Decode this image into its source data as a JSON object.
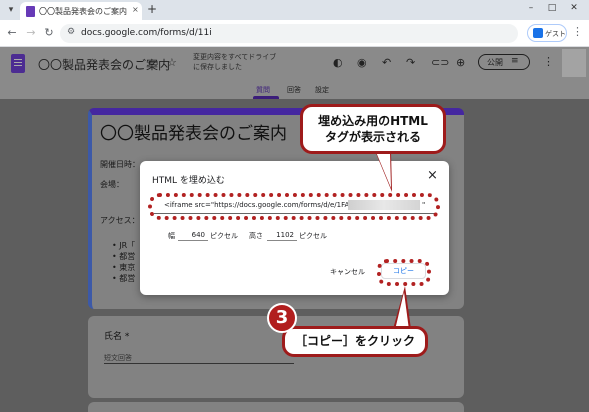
{
  "browser": {
    "tab_title": "〇〇製品発表会のご案内 - Google",
    "tab_close": "×",
    "new_tab": "+",
    "url": "docs.google.com/forms/d/11i",
    "profile_label": "ゲスト"
  },
  "form_header": {
    "title": "〇〇製品発表会のご案内",
    "save_note": "変更内容をすべてドライブに保存しました",
    "publish_label": "公開",
    "tabs": [
      {
        "label": "質問"
      },
      {
        "label": "回答"
      },
      {
        "label": "設定"
      }
    ]
  },
  "form_body": {
    "title": "〇〇製品発表会のご案内",
    "datetime_label": "開催日時：",
    "venue_label": "会場：",
    "access_label": "アクセス：",
    "bullets": [
      "JR「",
      "都営",
      "東京",
      "都営"
    ],
    "question_label": "氏名 *",
    "answer_placeholder": "短文回答"
  },
  "dialog": {
    "title": "HTML を埋め込む",
    "close": "×",
    "code": "<iframe src=\"https://docs.google.com/forms/d/e/1FAIp",
    "code_tail": "\"",
    "width_label": "幅",
    "width_value": "640",
    "width_unit": "ピクセル",
    "height_label": "高さ",
    "height_value": "1102",
    "height_unit": "ピクセル",
    "cancel_label": "キャンセル",
    "copy_label": "コピー"
  },
  "annotations": {
    "callout_top_line1": "埋め込み用のHTML",
    "callout_top_line2": "タグが表示される",
    "step_number": "3",
    "callout_bottom": "［コピー］をクリック"
  },
  "colors": {
    "form_accent": "#4527a0",
    "annotation_red": "#b22222",
    "link_blue": "#1a73e8"
  }
}
